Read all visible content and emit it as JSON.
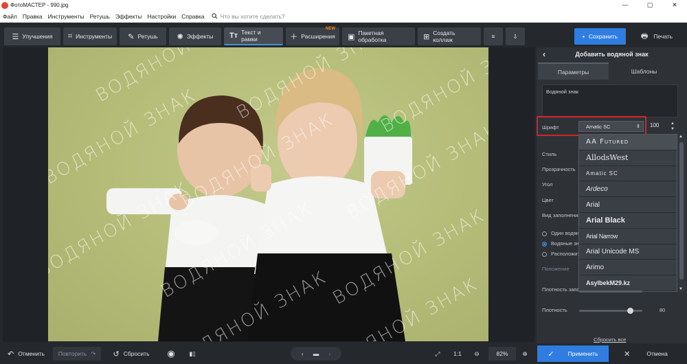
{
  "window": {
    "title": "ФотоМАСТЕР - 990.jpg",
    "minimize": "—",
    "maximize": "▢",
    "close": "✕"
  },
  "menu": {
    "items": [
      "Файл",
      "Правка",
      "Инструменты",
      "Ретушь",
      "Эффекты",
      "Настройки",
      "Справка"
    ],
    "search_placeholder": "Что вы хотите сделать?"
  },
  "toolbar": {
    "enhance": "Улучшения",
    "tools": "Инструменты",
    "retouch": "Ретушь",
    "effects": "Эффекты",
    "text_frames": "Текст и рамки",
    "extensions": "Расширения",
    "new_badge": "NEW",
    "batch": "Пакетная обработка",
    "collage": "Создать коллаж",
    "save": "Сохранить",
    "print": "Печать"
  },
  "watermark_text": "ВОДЯНОЙ ЗНАК",
  "panel": {
    "title": "Добавить водяной знак",
    "tab_params": "Параметры",
    "tab_templates": "Шаблоны",
    "text_value": "Водяной знак",
    "font_label": "Шрифт",
    "font_value": "Amatic SC",
    "font_size": "100",
    "style_label": "Стиль",
    "opacity_label": "Прозрачность",
    "angle_label": "Угол",
    "color_label": "Цвет",
    "fill_type_label": "Вид заполнения",
    "radio_one": "Один водяной знак",
    "radio_many": "Водяные знаки",
    "radio_arrange": "Расположить",
    "position_label": "Положение",
    "density_fill_label": "Плотность заполнения",
    "density_label": "Плотность",
    "density_value": "80",
    "density_level": 0.8,
    "reset": "Сбросить все"
  },
  "font_list": [
    "AA Futured",
    "AllodsWest",
    "Amatic SC",
    "Ardeco",
    "Arial",
    "Arial Black",
    "Arial Narrow",
    "Arial Unicode MS",
    "Arimo",
    "AsylbekM29.kz"
  ],
  "bottom": {
    "undo": "Отменить",
    "redo": "Повторить",
    "reset": "Сбросить",
    "ratio": "1:1",
    "zoom": "82%",
    "apply": "Применить",
    "cancel": "Отмена"
  },
  "colors": {
    "accent": "#2f7de1",
    "highlight": "#d7242e",
    "background": "#25282d"
  }
}
